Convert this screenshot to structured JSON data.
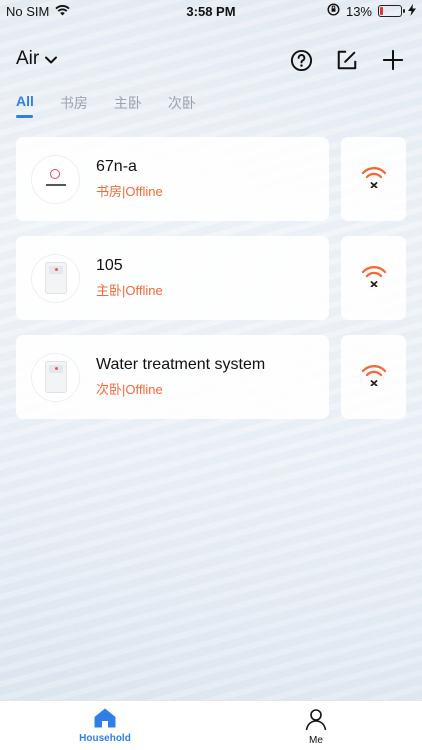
{
  "status_bar": {
    "carrier": "No SIM",
    "time": "3:58 PM",
    "battery_percent": "13%",
    "battery_level": 0.13,
    "battery_color": "#e0392b"
  },
  "header": {
    "home_name": "Air",
    "icons": [
      "help-icon",
      "edit-icon",
      "add-icon"
    ]
  },
  "tabs": [
    {
      "label": "All",
      "active": true
    },
    {
      "label": "书房",
      "active": false
    },
    {
      "label": "主卧",
      "active": false
    },
    {
      "label": "次卧",
      "active": false
    }
  ],
  "devices": [
    {
      "name": "67n-a",
      "status": "书房|Offline",
      "icon": "round-purifier-thumb",
      "connection_icon": "wifi-off-icon"
    },
    {
      "name": "105",
      "status": "主卧|Offline",
      "icon": "appliance-thumb",
      "connection_icon": "wifi-off-icon"
    },
    {
      "name": "Water treatment system",
      "status": "次卧|Offline",
      "icon": "appliance-thumb",
      "connection_icon": "wifi-off-icon"
    }
  ],
  "tab_bar": {
    "household_label": "Household",
    "me_label": "Me"
  },
  "colors": {
    "accent": "#2f7fe6",
    "offline": "#f06a3a"
  }
}
